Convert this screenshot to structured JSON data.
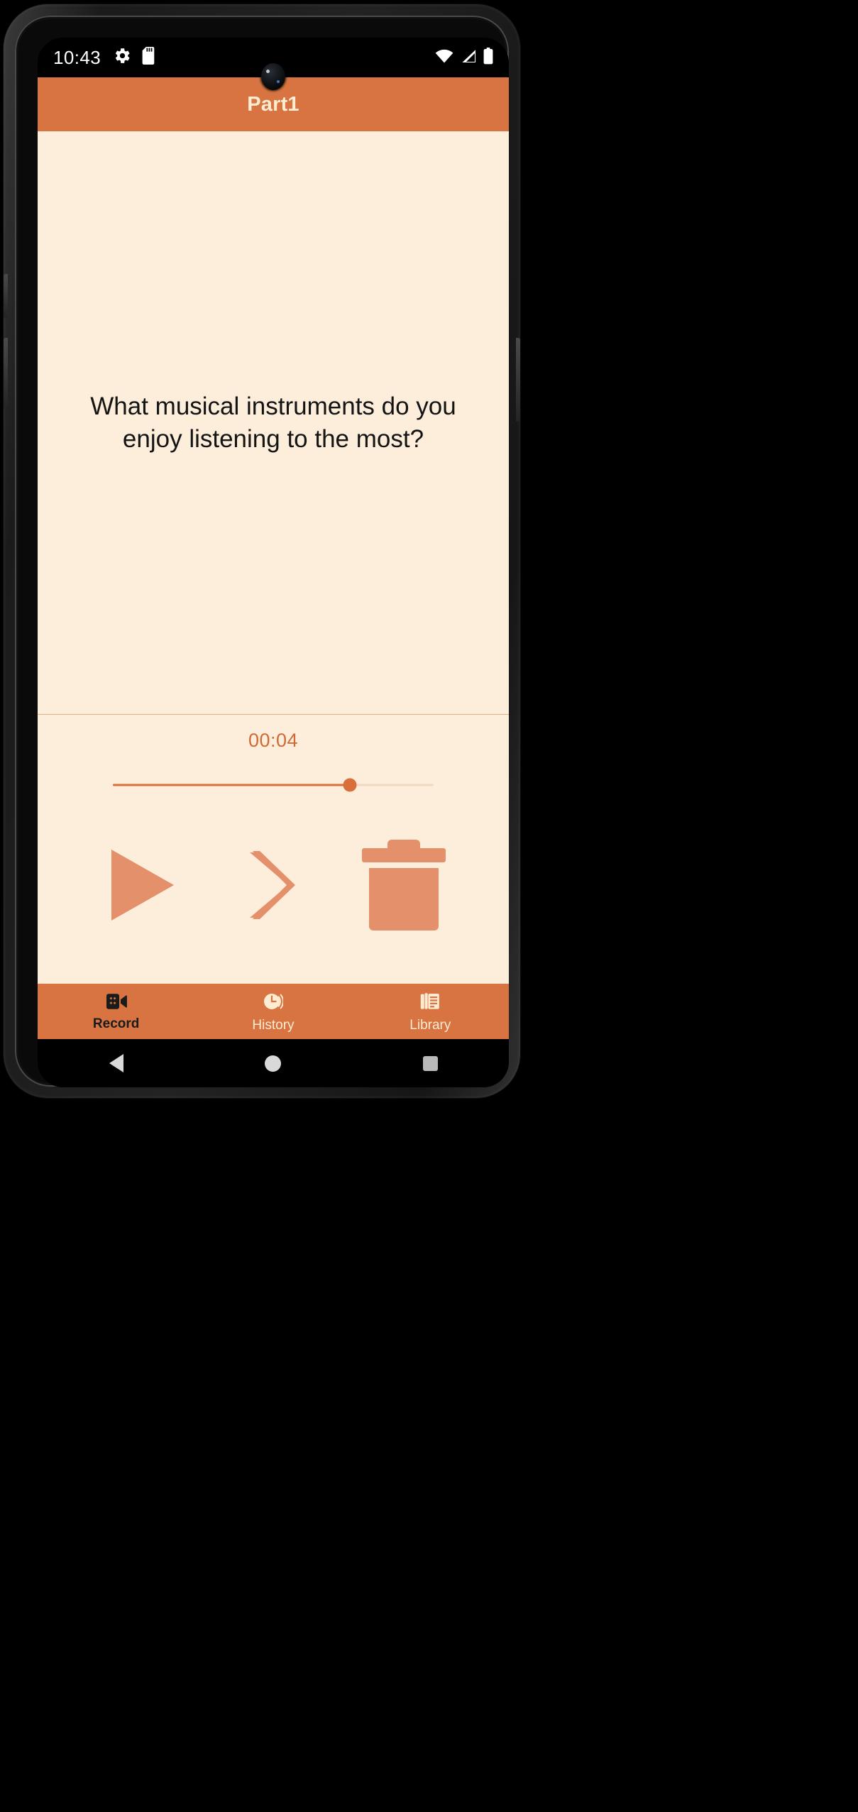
{
  "statusbar": {
    "time": "10:43",
    "left_icons": [
      "gear-icon",
      "sd-card-icon"
    ],
    "right_icons": [
      "wifi-icon",
      "cellular-signal-icon",
      "battery-icon"
    ]
  },
  "appbar": {
    "title": "Part1",
    "background_color": "#D87441",
    "title_color": "#FDEBD2"
  },
  "content": {
    "background_color": "#FCEEDA",
    "question": "What musical instruments do you enjoy listening to the most?"
  },
  "player": {
    "timer": "00:04",
    "timer_color": "#D06A36",
    "progress_percent": 74,
    "accent_color": "#D9703C",
    "track_color": "#EFD9C2",
    "controls": [
      {
        "name": "play-button",
        "icon": "play-icon",
        "label": "Play"
      },
      {
        "name": "next-button",
        "icon": "chevron-right-icon",
        "label": "Next"
      },
      {
        "name": "delete-button",
        "icon": "trash-icon",
        "label": "Delete"
      }
    ],
    "control_color": "#E4906A"
  },
  "bottom_nav": {
    "background_color": "#D87441",
    "items": [
      {
        "label": "Record",
        "icon": "video-record-icon",
        "active": true
      },
      {
        "label": "History",
        "icon": "clock-history-icon",
        "active": false
      },
      {
        "label": "Library",
        "icon": "library-books-icon",
        "active": false
      }
    ]
  },
  "android_nav": {
    "buttons": [
      "back-icon",
      "home-icon",
      "recents-icon"
    ]
  }
}
